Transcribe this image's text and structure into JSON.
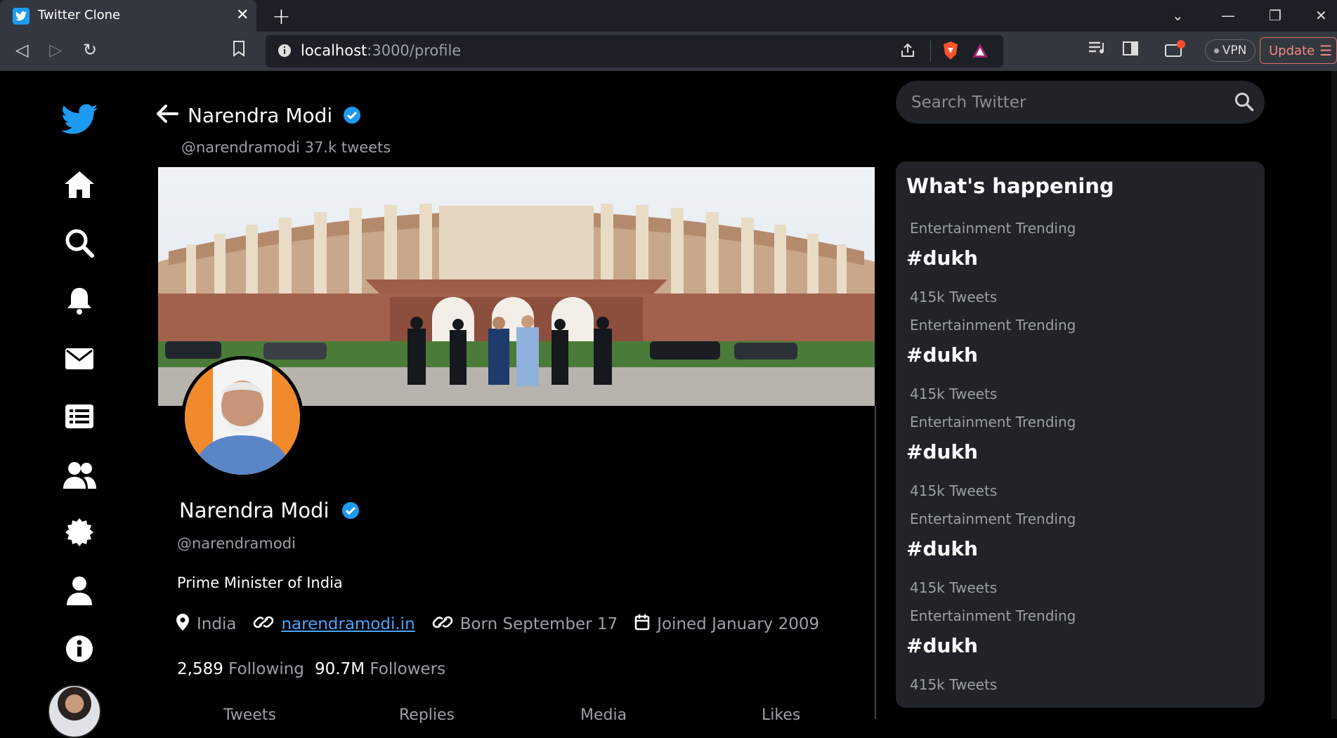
{
  "browser": {
    "tab_title": "Twitter Clone",
    "url_host": "localhost",
    "url_path": ":3000/profile",
    "vpn_label": "VPN",
    "update_label": "Update"
  },
  "header": {
    "name": "Narendra Modi",
    "handle": "@narendramodi",
    "tweet_count": "37.k tweets"
  },
  "profile": {
    "name": "Narendra Modi",
    "handle": "@narendramodi",
    "bio": "Prime Minister of India",
    "location": "India",
    "website": "narendramodi.in",
    "born": "Born September 17",
    "joined": "Joined January 2009",
    "following_count": "2,589",
    "following_label": "Following",
    "followers_count": "90.7M",
    "followers_label": "Followers"
  },
  "profile_tabs": [
    "Tweets",
    "Replies",
    "Media",
    "Likes"
  ],
  "search": {
    "placeholder": "Search Twitter"
  },
  "whats_happening": {
    "title": "What's happening",
    "trends": [
      {
        "category": "Entertainment",
        "status": "Trending",
        "tag": "#dukh",
        "count": "415k Tweets"
      },
      {
        "category": "Entertainment",
        "status": "Trending",
        "tag": "#dukh",
        "count": "415k Tweets"
      },
      {
        "category": "Entertainment",
        "status": "Trending",
        "tag": "#dukh",
        "count": "415k Tweets"
      },
      {
        "category": "Entertainment",
        "status": "Trending",
        "tag": "#dukh",
        "count": "415k Tweets"
      },
      {
        "category": "Entertainment",
        "status": "Trending",
        "tag": "#dukh",
        "count": "415k Tweets"
      }
    ]
  },
  "colors": {
    "accent": "#1d9bf0",
    "link": "#4aa3ff",
    "panel": "#202327",
    "muted": "#9aa0a6"
  },
  "nav_icons": [
    "twitter-logo-icon",
    "home-icon",
    "search-icon",
    "bell-icon",
    "mail-icon",
    "list-icon",
    "people-icon",
    "gear-icon",
    "user-icon",
    "info-icon"
  ]
}
